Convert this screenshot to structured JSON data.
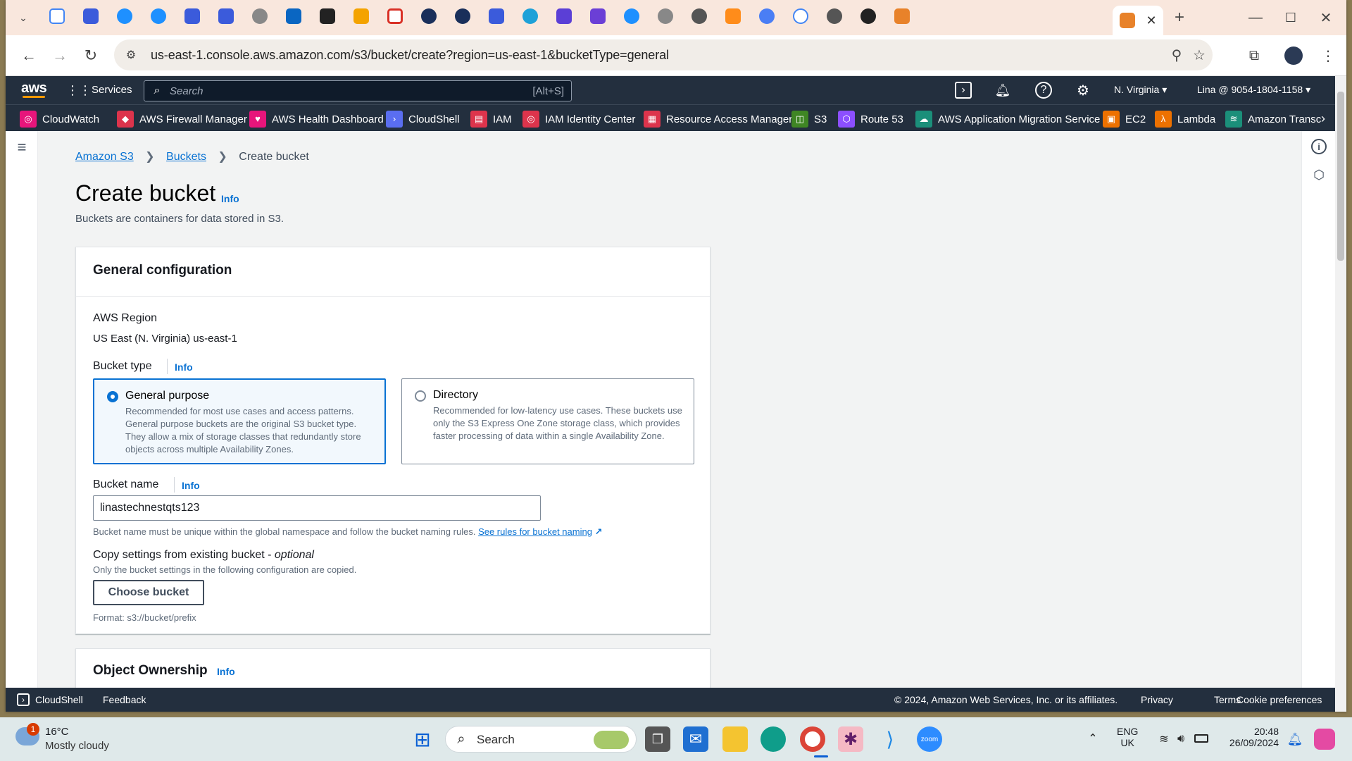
{
  "browser": {
    "url": "us-east-1.console.aws.amazon.com/s3/bucket/create?region=us-east-1&bucketType=general"
  },
  "aws": {
    "services_label": "Services",
    "search_placeholder": "Search",
    "search_shortcut": "[Alt+S]",
    "region": "N. Virginia",
    "account": "Lina @ 9054-1804-1158"
  },
  "favorites": [
    "CloudWatch",
    "AWS Firewall Manager",
    "AWS Health Dashboard",
    "CloudShell",
    "IAM",
    "IAM Identity Center",
    "Resource Access Manager",
    "S3",
    "Route 53",
    "AWS Application Migration Service",
    "EC2",
    "Lambda",
    "Amazon Transc"
  ],
  "breadcrumb": {
    "c1": "Amazon S3",
    "c2": "Buckets",
    "c3": "Create bucket"
  },
  "page": {
    "title": "Create bucket",
    "title_info": "Info",
    "desc": "Buckets are containers for data stored in S3."
  },
  "general": {
    "heading": "General configuration",
    "region_label": "AWS Region",
    "region_value": "US East (N. Virginia) us-east-1",
    "bucket_type_label": "Bucket type",
    "bucket_type_info": "Info",
    "opt1_title": "General purpose",
    "opt1_desc": "Recommended for most use cases and access patterns. General purpose buckets are the original S3 bucket type. They allow a mix of storage classes that redundantly store objects across multiple Availability Zones.",
    "opt2_title": "Directory",
    "opt2_desc": "Recommended for low-latency use cases. These buckets use only the S3 Express One Zone storage class, which provides faster processing of data within a single Availability Zone.",
    "name_label": "Bucket name",
    "name_info": "Info",
    "name_value": "linastechnestqts123",
    "name_hint": "Bucket name must be unique within the global namespace and follow the bucket naming rules.",
    "name_rules_link": "See rules for bucket naming",
    "copy_label": "Copy settings from existing bucket - ",
    "copy_optional": "optional",
    "copy_desc": "Only the bucket settings in the following configuration are copied.",
    "choose_button": "Choose bucket",
    "format_hint": "Format: s3://bucket/prefix"
  },
  "ownership": {
    "heading": "Object Ownership",
    "info": "Info"
  },
  "footer": {
    "cloudshell": "CloudShell",
    "feedback": "Feedback",
    "copyright": "© 2024, Amazon Web Services, Inc. or its affiliates.",
    "privacy": "Privacy",
    "terms": "Terms",
    "cookie": "Cookie preferences"
  },
  "taskbar": {
    "weather_badge": "1",
    "temp": "16°C",
    "condition": "Mostly cloudy",
    "search": "Search",
    "lang1": "ENG",
    "lang2": "UK",
    "time": "20:48",
    "date": "26/09/2024"
  }
}
